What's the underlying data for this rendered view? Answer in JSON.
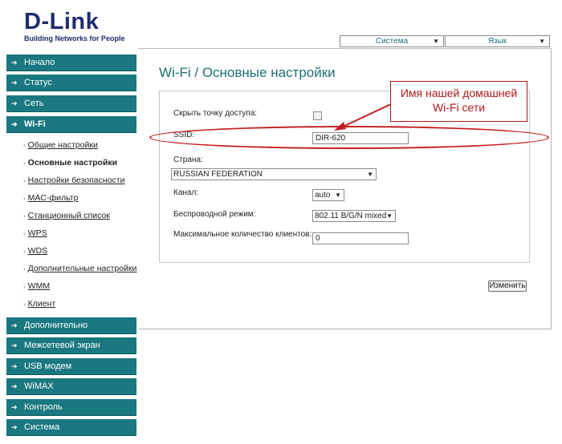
{
  "header": {
    "logo_text": "D-Link",
    "logo_tagline": "Building Networks for People",
    "system_select": "Система",
    "lang_select": "Язык"
  },
  "sidebar": {
    "items": [
      {
        "label": "Начало"
      },
      {
        "label": "Статус"
      },
      {
        "label": "Сеть"
      },
      {
        "label": "Wi-Fi"
      },
      {
        "label": "Дополнительно"
      },
      {
        "label": "Межсетевой экран"
      },
      {
        "label": "USB модем"
      },
      {
        "label": "WiMAX"
      },
      {
        "label": "Контроль"
      },
      {
        "label": "Система"
      }
    ],
    "wifi_subitems": [
      {
        "label": "Общие настройки"
      },
      {
        "label": "Основные настройки"
      },
      {
        "label": "Настройки безопасности"
      },
      {
        "label": "MAC-фильтр"
      },
      {
        "label": "Станционный список"
      },
      {
        "label": "WPS"
      },
      {
        "label": "WDS"
      },
      {
        "label": "Дополнительные настройки"
      },
      {
        "label": "WMM"
      },
      {
        "label": "Клиент"
      }
    ]
  },
  "main": {
    "title": "Wi-Fi / Основные настройки",
    "hide_ap_label": "Скрыть точку доступа:",
    "hide_ap_checked": false,
    "ssid_label": "SSID:",
    "ssid_value": "DIR-620",
    "country_label": "Страна:",
    "country_value": "RUSSIAN FEDERATION",
    "channel_label": "Канал:",
    "channel_value": "auto",
    "mode_label": "Беспроводной режим:",
    "mode_value": "802.11 B/G/N mixed",
    "max_clients_label": "Максимальное количество клиентов:",
    "max_clients_value": "0",
    "change_button": "Изменить"
  },
  "annotation": {
    "callout_line1": "Имя нашей домашней",
    "callout_line2": "Wi-Fi сети",
    "color": "#c41c1c"
  },
  "colors": {
    "nav_bg": "#1a7880",
    "brand": "#1e2d6b",
    "title": "#1a6f78"
  }
}
